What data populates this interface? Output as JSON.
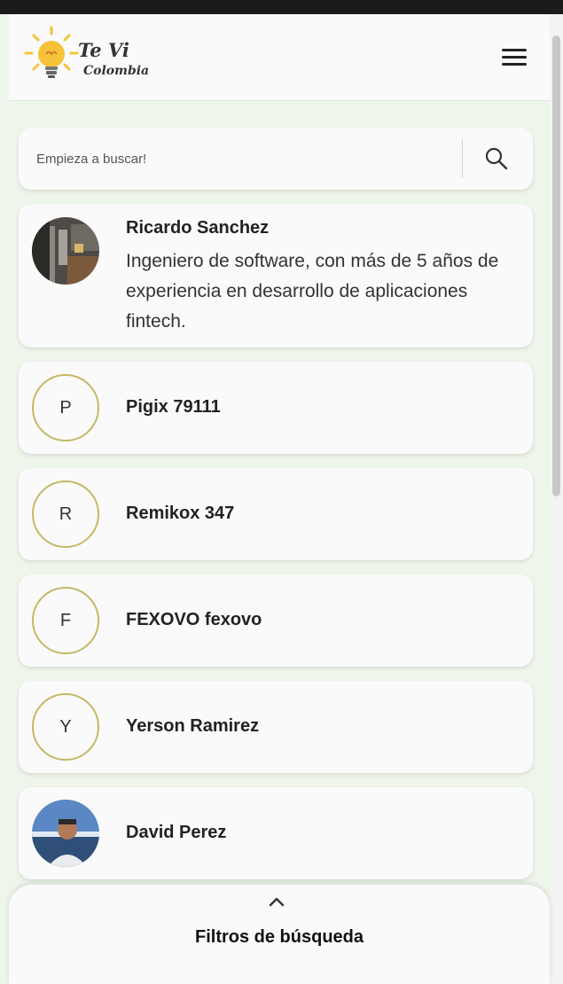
{
  "header": {
    "logo_line1": "Te Vi",
    "logo_line2": "Colombia",
    "menu_icon": "hamburger-icon"
  },
  "search": {
    "placeholder": "Empieza a buscar!",
    "icon": "search-icon"
  },
  "profiles": [
    {
      "name": "Ricardo Sanchez",
      "description": "Ingeniero de software, con más de 5 años de experiencia en desarrollo de aplicaciones fintech.",
      "avatar_type": "photo"
    },
    {
      "name": "Pigix 79111",
      "initial": "P",
      "avatar_type": "initial"
    },
    {
      "name": "Remikox 347",
      "initial": "R",
      "avatar_type": "initial"
    },
    {
      "name": "FEXOVO fexovo",
      "initial": "F",
      "avatar_type": "initial"
    },
    {
      "name": "Yerson Ramirez",
      "initial": "Y",
      "avatar_type": "initial"
    },
    {
      "name": "David Perez",
      "avatar_type": "photo"
    }
  ],
  "filters": {
    "title": "Filtros de búsqueda",
    "toggle_icon": "chevron-up-icon"
  },
  "colors": {
    "page_background": "#eef5ea",
    "card_background": "#fafafa",
    "initial_avatar_border": "#c4b865",
    "logo_bulb": "#f6c23a"
  }
}
